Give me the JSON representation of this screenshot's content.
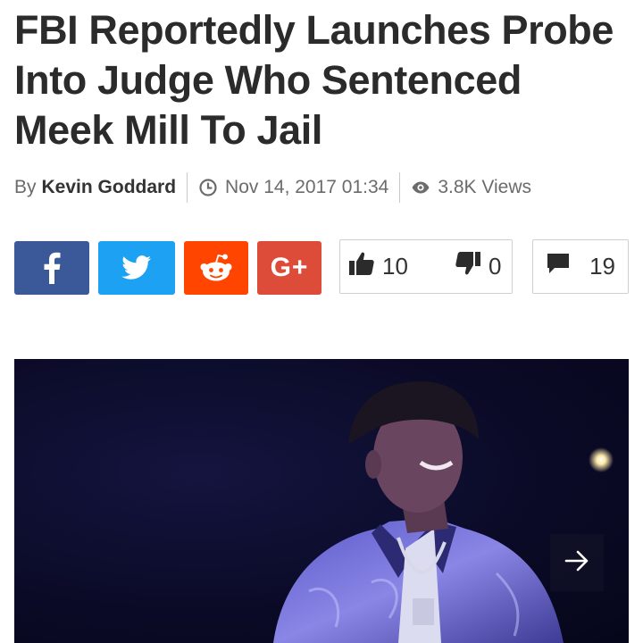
{
  "article": {
    "title": "FBI Reportedly Launches Probe Into Judge Who Sentenced Meek Mill To Jail",
    "by_prefix": "By",
    "author": "Kevin Goddard",
    "date": "Nov 14, 2017 01:34",
    "views": "3.8K Views"
  },
  "share": {
    "facebook": {
      "icon": "facebook-icon",
      "color": "#3b5998"
    },
    "twitter": {
      "icon": "twitter-icon",
      "color": "#1da1f2"
    },
    "reddit": {
      "icon": "reddit-icon",
      "color": "#ff4500"
    },
    "googleplus": {
      "icon": "google-plus-icon",
      "label": "G+",
      "color": "#dd4b39"
    }
  },
  "votes": {
    "up": "10",
    "down": "0"
  },
  "comments": {
    "count": "19"
  },
  "photo": {
    "icon": "arrow-right-icon"
  }
}
